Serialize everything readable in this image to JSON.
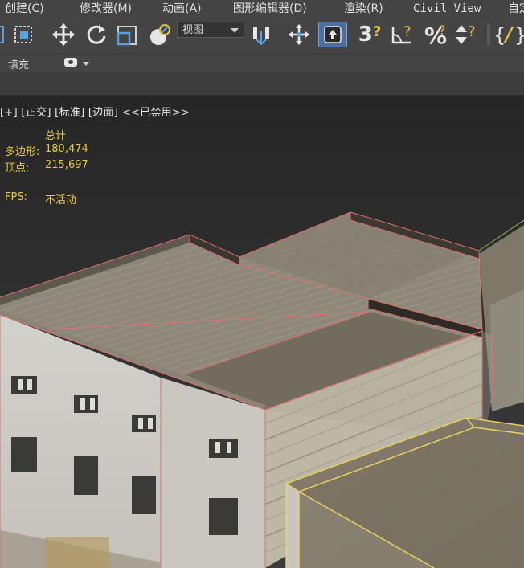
{
  "menu": {
    "items": [
      "创建(C)",
      "修改器(M)",
      "动画(A)",
      "图形编辑器(D)",
      "渲染(R)",
      "Civil View",
      "自定"
    ]
  },
  "toolbar": {
    "view_selector": "视图",
    "snap_label": "3"
  },
  "ribbon": {
    "fill_label": "填充"
  },
  "viewport": {
    "label": "[+] [正交] [标准] [边面] <<已禁用>>",
    "stats_header": "总计",
    "polygons_label": "多边形:",
    "polygons_value": "180,474",
    "vertices_label": "顶点:",
    "vertices_value": "215,697",
    "fps_label": "FPS:",
    "fps_value": "不活动"
  },
  "colors": {
    "ui_background": "#444444",
    "viewport_background": "#2c2c2c",
    "stats_text": "#e8c84a",
    "edge_highlight": "#e07070",
    "selected_edge": "#e8d060",
    "active_tool": "#4a6fa0"
  }
}
